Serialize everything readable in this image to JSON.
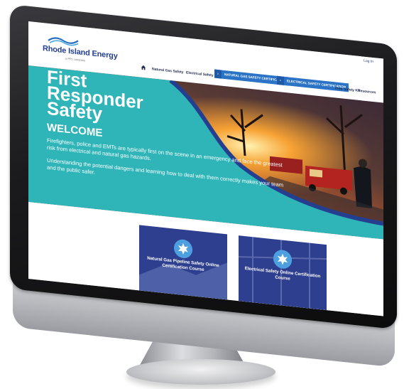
{
  "brand": {
    "name": "Rhode Island Energy",
    "subtitle": "a PPL company"
  },
  "header": {
    "login_label": "Log In"
  },
  "nav": {
    "home_icon": "home-icon",
    "natural_gas_safety": "Natural Gas Safety",
    "electrical_safety": "Electrical Safety",
    "natural_gas_cert": "NATURAL GAS SAFETY CERTIFICATION",
    "electrical_cert": "ELECTRICAL SAFETY CERTIFICATION",
    "free_safety_kit": "Free Safety Kit",
    "resources": "Resources"
  },
  "hero": {
    "title": "First\nResponder\nSafety",
    "welcome": "WELCOME",
    "paragraph_1": "Firefighters, police and EMTs are typically first on the scene in an emergency and face the greatest risk from electrical and natural gas hazards.",
    "paragraph_2": "Understanding the potential dangers and learning how to deal with them correctly makes your team and the public safer."
  },
  "cards": [
    {
      "label": "Natural Gas Pipeline Safety Online Certification Course",
      "icon": "badge-icon"
    },
    {
      "label": "Electrical Safety Online Certification Course",
      "icon": "badge-icon"
    }
  ],
  "colors": {
    "brand_blue": "#243f8f",
    "teal": "#2fb5b8",
    "chip_blue": "#2a73c6",
    "card_navy": "#2f3f8f"
  }
}
